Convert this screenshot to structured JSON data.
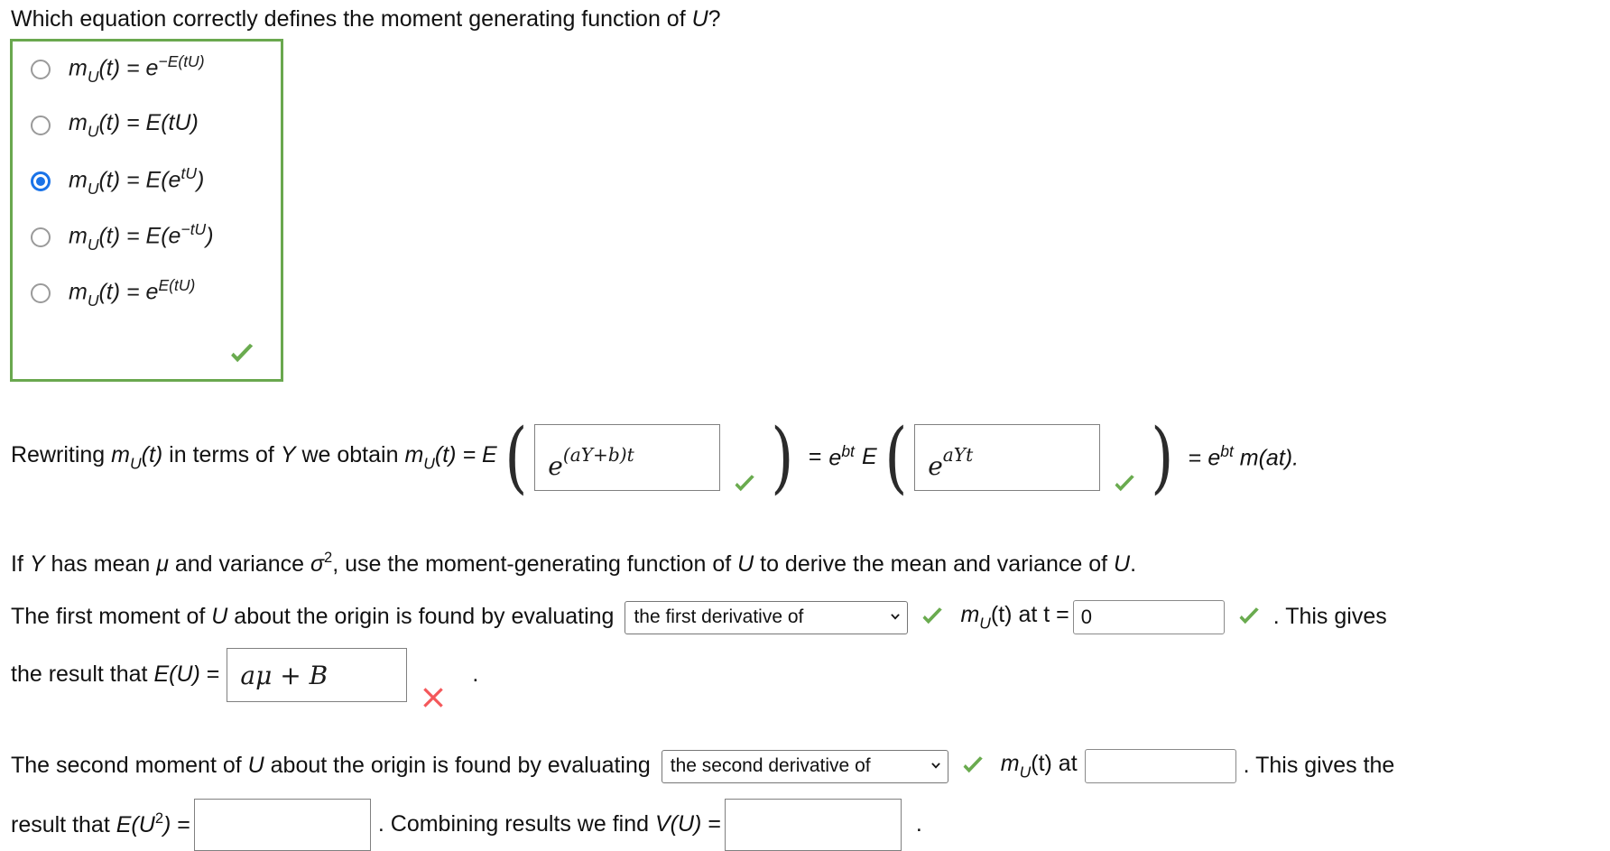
{
  "question": {
    "prompt_before": "Which equation correctly defines the moment generating function of ",
    "prompt_var": "U",
    "prompt_after": "?"
  },
  "options": {
    "selected_index": 2,
    "items": [
      {
        "id": "opt-1",
        "m": "m",
        "sub": "U",
        "rest": "(t) = e",
        "sup": "−E(tU)",
        "checked": false
      },
      {
        "id": "opt-2",
        "m": "m",
        "sub": "U",
        "rest": "(t) = E(tU)",
        "sup": "",
        "checked": false
      },
      {
        "id": "opt-3",
        "m": "m",
        "sub": "U",
        "rest": "(t) = E(e",
        "sup": "tU",
        "tail": ")",
        "checked": true
      },
      {
        "id": "opt-4",
        "m": "m",
        "sub": "U",
        "rest": "(t) = E(e",
        "sup": "−tU",
        "tail": ")",
        "checked": false
      },
      {
        "id": "opt-5",
        "m": "m",
        "sub": "U",
        "rest": "(t) = e",
        "sup": "E(tU)",
        "checked": false
      }
    ],
    "feedback": "correct"
  },
  "rewriting": {
    "lead_1": "Rewriting ",
    "m1": "m",
    "m1_sub": "U",
    "m1_rest": "(t)",
    "mid": " in terms of ",
    "y": "Y",
    "mid2": " we obtain ",
    "m2": "m",
    "m2_sub": "U",
    "m2_rest": "(t) = ",
    "E1": "E",
    "answer_1": "e^{(aY+b)t}",
    "answer_1_base": "e",
    "answer_1_exp": "(aY+b)t",
    "answer_1_status": "correct",
    "eq_mid": "=",
    "ebt": "e",
    "ebt_sup": "bt",
    "E2": "E",
    "answer_2_base": "e",
    "answer_2_exp": "aYt",
    "answer_2_status": "correct",
    "eq_end": "=",
    "ebt2": "e",
    "ebt2_sup": "bt",
    "tail": " m(at)."
  },
  "derive": {
    "line": "If Y has mean μ and variance σ², use the moment-generating function of U to derive the mean and variance of U.",
    "part_a": "If ",
    "y": "Y",
    "part_b": " has mean ",
    "mu": "μ",
    "part_c": " and variance ",
    "sigma": "σ",
    "sigma_sup": "2",
    "part_d": ", use the moment-generating function of ",
    "u1": "U",
    "part_e": " to derive the mean and variance of ",
    "u2": "U",
    "part_f": "."
  },
  "first_moment": {
    "lead": "The first moment of ",
    "u": "U",
    "lead2": " about the origin is found by evaluating",
    "select_value": "the first derivative of",
    "select_status": "correct",
    "m": "m",
    "m_sub": "U",
    "m_rest": "(t) at t = ",
    "t_value": "0",
    "t_status": "correct",
    "tail": ". This gives",
    "result_lead": "the result that E(U) = ",
    "result_lead_a": "the result that ",
    "result_E": "E",
    "result_U": "(U)",
    "result_eq": " = ",
    "result_value": "aμ + B",
    "result_value_base": "aμ",
    "result_value_op": "+",
    "result_value_b": "B",
    "result_status": "incorrect",
    "result_period": "."
  },
  "second_moment": {
    "lead": "The second moment of ",
    "u": "U",
    "lead2": " about the origin is found by evaluating",
    "select_value": "the second derivative of",
    "select_status": "correct",
    "m": "m",
    "m_sub": "U",
    "m_rest": "(t) at",
    "at_value": "",
    "tail": ". This gives the",
    "result_lead": "result that ",
    "result_E": "E",
    "result_U": "(U",
    "result_U_sup": "2",
    "result_U_close": ")",
    "result_eq": " = ",
    "eu2_value": "",
    "combining": ". Combining results we find ",
    "v": "V",
    "v_u": "(U)",
    "v_eq": " = ",
    "vu_value": "",
    "period": "."
  },
  "colors": {
    "box_border_green": "#6aa84f",
    "check_green": "#6aab4f",
    "cross_red": "#f4575a",
    "radio_blue": "#1a73e8",
    "field_border": "#808080"
  }
}
